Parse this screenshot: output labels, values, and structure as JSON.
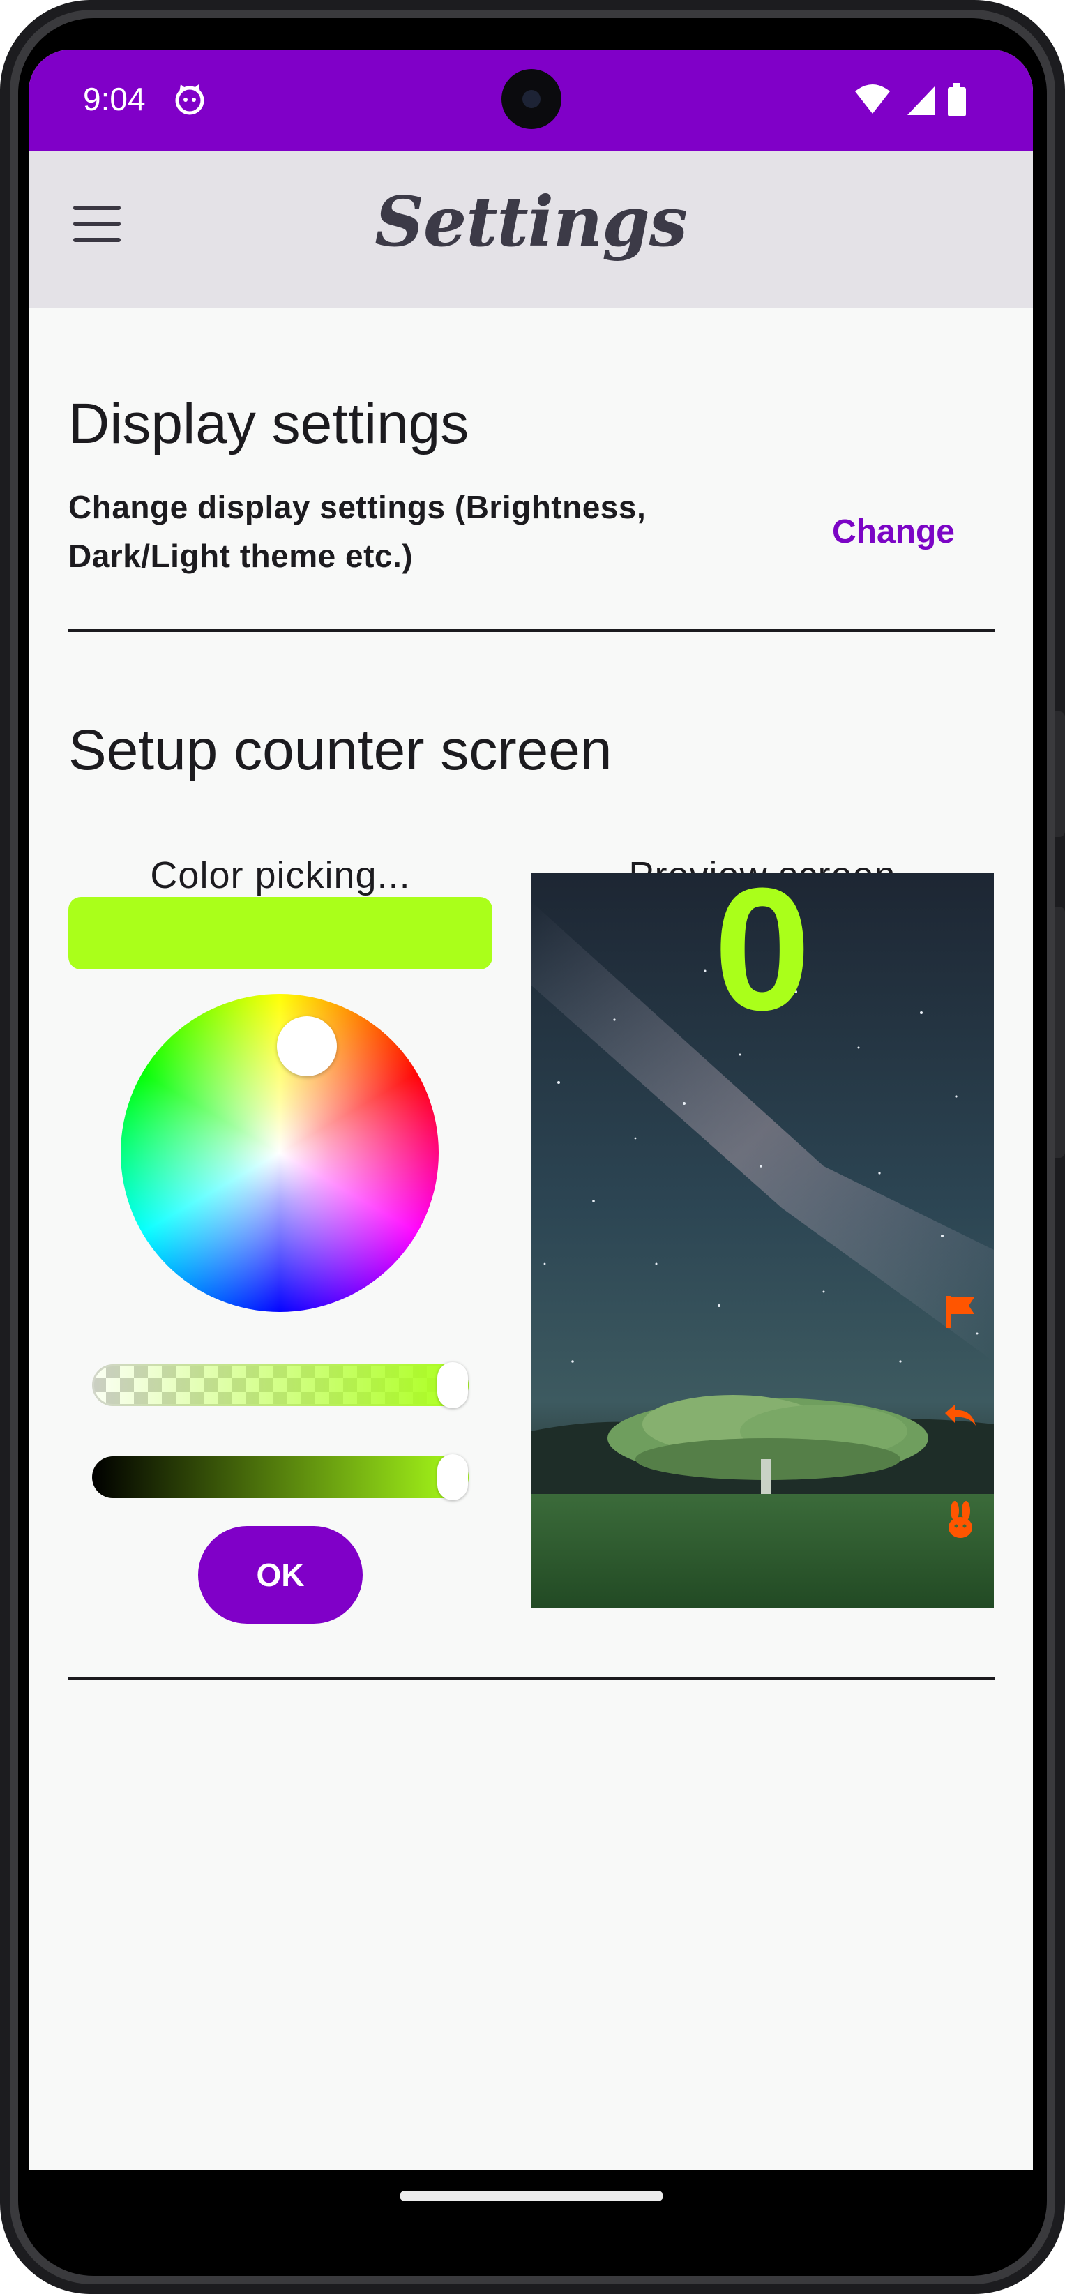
{
  "status_bar": {
    "time": "9:04",
    "app_icon": "cat-face-icon",
    "icons": [
      "wifi-icon",
      "signal-icon",
      "battery-icon"
    ],
    "background_color": "#8000c8"
  },
  "app_bar": {
    "title": "Settings",
    "menu_icon": "hamburger-menu-icon",
    "background_color": "#e4e2e7"
  },
  "display_settings": {
    "heading": "Display settings",
    "description_line1": "Change display settings (Brightness,",
    "description_line2": "Dark/Light theme etc.)",
    "change_label": "Change"
  },
  "counter_setup": {
    "heading": "Setup counter screen",
    "color_picker": {
      "label": "Color picking...",
      "selected_color": "#aaff1a",
      "alpha_level": 1.0,
      "value_level": 1.0,
      "ok_label": "OK"
    },
    "preview": {
      "label": "Preview screen",
      "counter_value": "0",
      "counter_color": "#aaff1a",
      "background": "starry-night-tree-photo",
      "icons": [
        "flag-icon",
        "undo-icon",
        "rabbit-icon"
      ],
      "icon_color": "#ff5500"
    }
  },
  "accent_color": "#7b05c5"
}
